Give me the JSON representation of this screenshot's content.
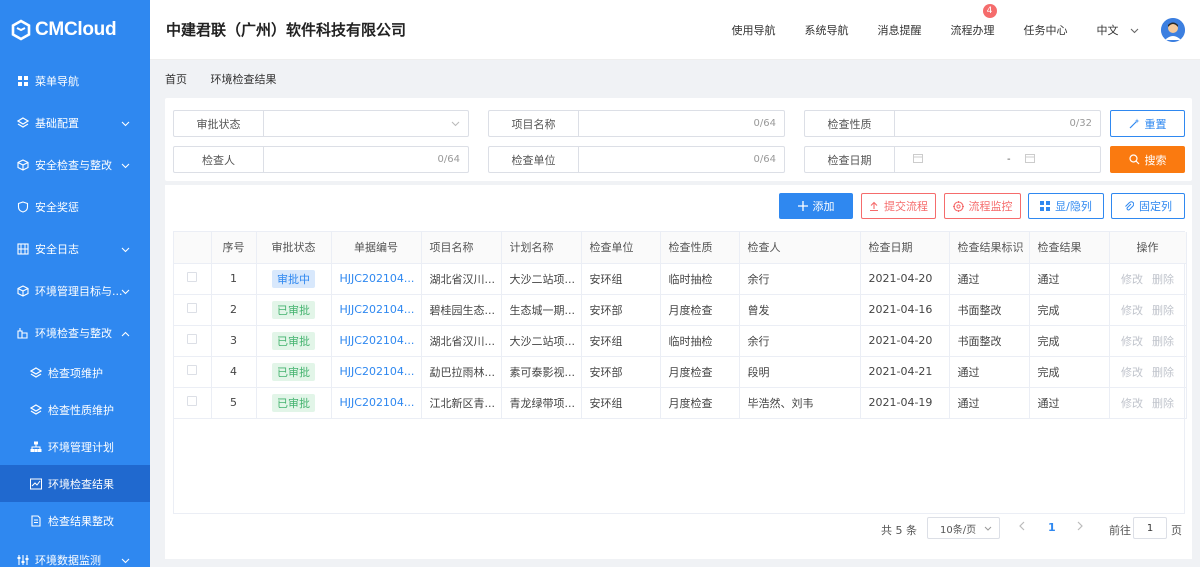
{
  "sidebar": {
    "logo": "CMCloud",
    "items": [
      {
        "label": "菜单导航",
        "icon": "grid-icon"
      },
      {
        "label": "基础配置",
        "icon": "layers-icon"
      },
      {
        "label": "安全检查与整改",
        "icon": "cube-icon"
      },
      {
        "label": "安全奖惩",
        "icon": "shield-icon"
      },
      {
        "label": "安全日志",
        "icon": "film-icon"
      },
      {
        "label": "环境管理目标与...",
        "icon": "cube-icon"
      },
      {
        "label": "环境检查与整改",
        "icon": "briefcase-icon"
      }
    ],
    "sub_items": [
      {
        "label": "检查项维护",
        "icon": "layers-icon"
      },
      {
        "label": "检查性质维护",
        "icon": "layers-icon"
      },
      {
        "label": "环境管理计划",
        "icon": "org-icon"
      },
      {
        "label": "环境检查结果",
        "icon": "chart-icon"
      },
      {
        "label": "检查结果整改",
        "icon": "doc-icon"
      }
    ],
    "last_item": {
      "label": "环境数据监测",
      "icon": "sliders-icon"
    }
  },
  "header": {
    "company": "中建君联（广州）软件科技有限公司",
    "nav": [
      "使用导航",
      "系统导航",
      "消息提醒",
      "流程办理",
      "任务中心"
    ],
    "badge": "4",
    "lang": "中文"
  },
  "breadcrumb": [
    "首页",
    "环境检查结果"
  ],
  "filters": {
    "status": {
      "label": "审批状态"
    },
    "project": {
      "label": "项目名称",
      "count": "0/64"
    },
    "nature": {
      "label": "检查性质",
      "count": "0/32"
    },
    "inspector": {
      "label": "检查人",
      "count": "0/64"
    },
    "unit": {
      "label": "检查单位",
      "count": "0/64"
    },
    "date": {
      "label": "检查日期",
      "sep": "-"
    },
    "reset": "重置",
    "search": "搜索"
  },
  "toolbar": {
    "add": "添加",
    "submit": "提交流程",
    "monitor": "流程监控",
    "toggle": "显/隐列",
    "pin": "固定列"
  },
  "table": {
    "columns": [
      "序号",
      "审批状态",
      "单据编号",
      "项目名称",
      "计划名称",
      "检查单位",
      "检查性质",
      "检查人",
      "检查日期",
      "检查结果标识",
      "检查结果",
      "操作"
    ],
    "rows": [
      {
        "no": "1",
        "status": "审批中",
        "code": "HJJC202104...",
        "project": "湖北省汉川...",
        "plan": "大沙二站项...",
        "unit": "安环组",
        "nature": "临时抽检",
        "inspector": "余行",
        "date": "2021-04-20",
        "flag": "通过",
        "result": "通过"
      },
      {
        "no": "2",
        "status": "已审批",
        "code": "HJJC202104...",
        "project": "碧桂园生态...",
        "plan": "生态城一期...",
        "unit": "安环部",
        "nature": "月度检查",
        "inspector": "曾发",
        "date": "2021-04-16",
        "flag": "书面整改",
        "result": "完成"
      },
      {
        "no": "3",
        "status": "已审批",
        "code": "HJJC202104...",
        "project": "湖北省汉川...",
        "plan": "大沙二站项...",
        "unit": "安环组",
        "nature": "临时抽检",
        "inspector": "余行",
        "date": "2021-04-20",
        "flag": "书面整改",
        "result": "完成"
      },
      {
        "no": "4",
        "status": "已审批",
        "code": "HJJC202104...",
        "project": "勐巴拉雨林...",
        "plan": "素可泰影视...",
        "unit": "安环部",
        "nature": "月度检查",
        "inspector": "段明",
        "date": "2021-04-21",
        "flag": "通过",
        "result": "完成"
      },
      {
        "no": "5",
        "status": "已审批",
        "code": "HJJC202104...",
        "project": "江北新区青...",
        "plan": "青龙绿带项...",
        "unit": "安环组",
        "nature": "月度检查",
        "inspector": "毕浩然、刘韦",
        "date": "2021-04-19",
        "flag": "通过",
        "result": "通过"
      }
    ],
    "ops": {
      "edit": "修改",
      "delete": "删除"
    }
  },
  "pager": {
    "total": "共 5 条",
    "size": "10条/页",
    "current": "1",
    "goto": "前往",
    "goto_value": "1",
    "page": "页"
  },
  "colors": {
    "primary": "#2f88f0",
    "orange": "#fa7a10",
    "red": "#f56c6c",
    "green": "#44b36f"
  }
}
